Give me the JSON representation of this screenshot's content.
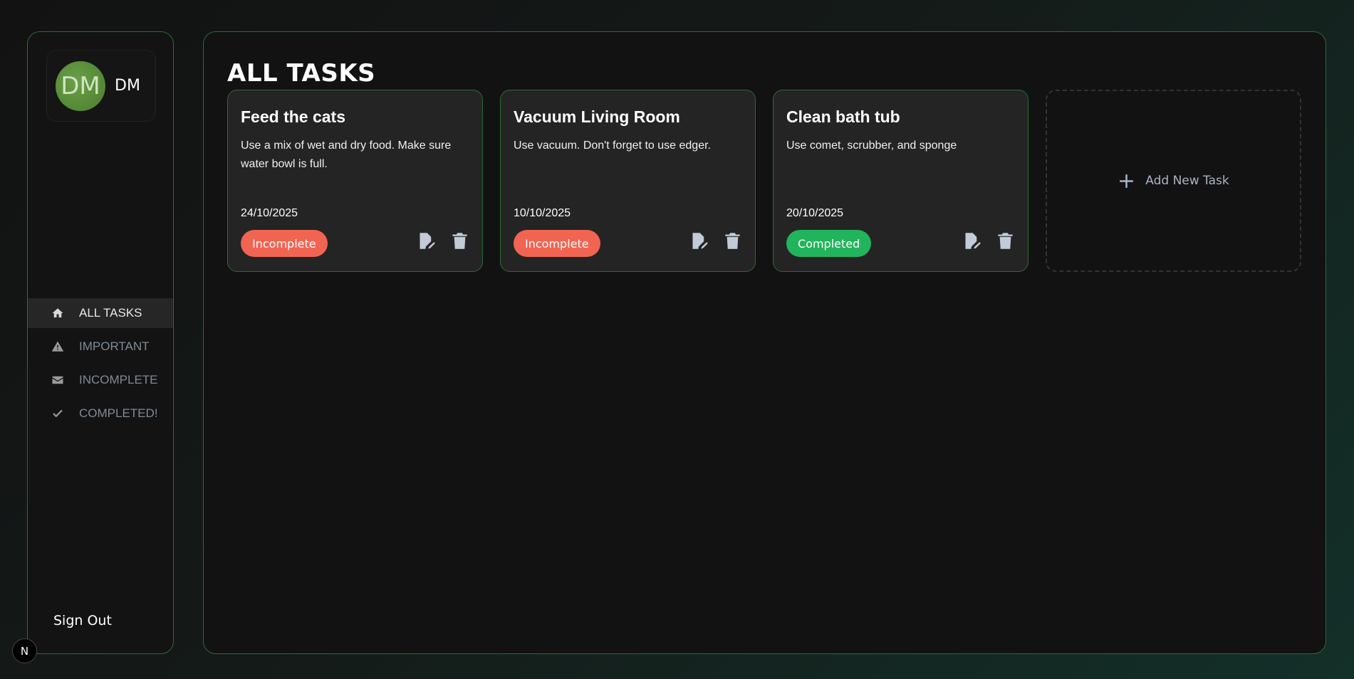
{
  "sidebar": {
    "profile": {
      "avatar_initials": "DM",
      "name": "DM"
    },
    "nav": [
      {
        "label": "ALL TASKS",
        "icon": "home-icon",
        "active": true
      },
      {
        "label": "IMPORTANT",
        "icon": "warning-icon",
        "active": false
      },
      {
        "label": "INCOMPLETE",
        "icon": "envelope-icon",
        "active": false
      },
      {
        "label": "COMPLETED!",
        "icon": "check-icon",
        "active": false
      }
    ],
    "signout_label": "Sign Out",
    "corner_badge": "N"
  },
  "main": {
    "title": "ALL TASKS",
    "tasks": [
      {
        "title": "Feed the cats",
        "description": "Use a mix of wet and dry food. Make sure water bowl is full.",
        "date": "24/10/2025",
        "status": "Incomplete",
        "status_color": "#f26452"
      },
      {
        "title": "Vacuum Living Room",
        "description": "Use vacuum. Don't forget to use edger.",
        "date": "10/10/2025",
        "status": "Incomplete",
        "status_color": "#f26452"
      },
      {
        "title": "Clean bath tub",
        "description": "Use comet, scrubber, and sponge",
        "date": "20/10/2025",
        "status": "Completed",
        "status_color": "#22b45c"
      }
    ],
    "add_task_label": "Add New Task"
  },
  "colors": {
    "accent_border": "#2d6a35",
    "incomplete": "#f26452",
    "completed": "#22b45c"
  }
}
